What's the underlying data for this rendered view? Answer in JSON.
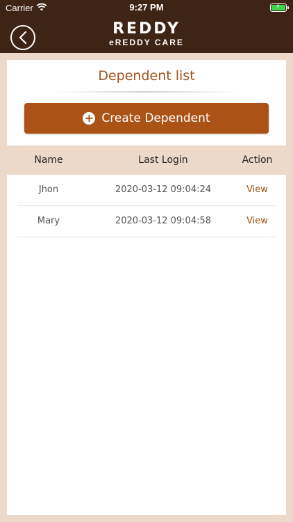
{
  "status_bar": {
    "carrier": "Carrier",
    "time": "9:27 PM",
    "battery_color": "#3fd34a"
  },
  "header": {
    "back_icon": "chevron-left-icon",
    "brand": "REDDY",
    "subtitle": "eREDDY CARE",
    "background_color": "#3e2415"
  },
  "page": {
    "title": "Dependent list",
    "create_button": {
      "icon": "plus-circle-icon",
      "label": "Create Dependent",
      "color": "#ab5317"
    }
  },
  "table": {
    "columns": [
      "Name",
      "Last Login",
      "Action"
    ],
    "rows": [
      {
        "name": "Jhon",
        "last_login": "2020-03-12 09:04:24",
        "action": "View"
      },
      {
        "name": "Mary",
        "last_login": "2020-03-12 09:04:58",
        "action": "View"
      }
    ]
  },
  "colors": {
    "accent": "#a4521a",
    "page_background": "#ecd9ca",
    "header_row_background": "#ecd9ca"
  }
}
